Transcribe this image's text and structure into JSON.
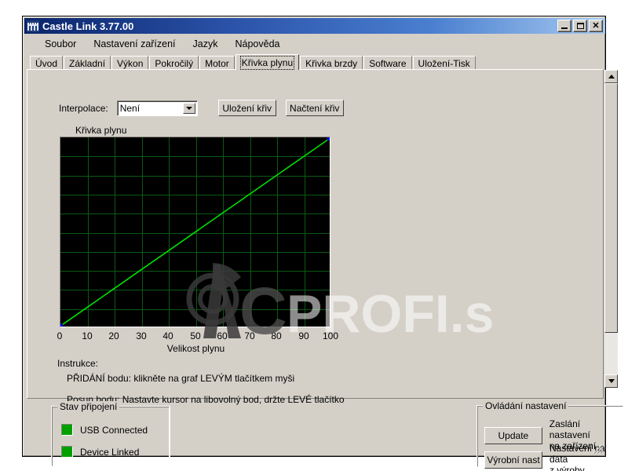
{
  "window": {
    "title": "Castle Link 3.77.00",
    "icon": "castle-icon",
    "buttons": {
      "minimize": "minimize-icon",
      "maximize": "maximize-icon",
      "close": "close-icon"
    }
  },
  "menubar": {
    "items": [
      {
        "label": "Soubor"
      },
      {
        "label": "Nastavení zařízení"
      },
      {
        "label": "Jazyk"
      },
      {
        "label": "Nápověda"
      }
    ]
  },
  "tabs": {
    "active_index": 5,
    "items": [
      {
        "label": "Úvod"
      },
      {
        "label": "Základní"
      },
      {
        "label": "Výkon"
      },
      {
        "label": "Pokročilý"
      },
      {
        "label": "Motor"
      },
      {
        "label": "Křivka plynu"
      },
      {
        "label": "Křivka brzdy"
      },
      {
        "label": "Software"
      },
      {
        "label": "Uložení-Tisk"
      }
    ]
  },
  "toolbar": {
    "interpolation_label": "Interpolace:",
    "interpolation_value": "Není",
    "interpolation_options": [
      "Není"
    ],
    "save_curve_label": "Uložení křiv",
    "load_curve_label": "Načtení křiv"
  },
  "chart_data": {
    "type": "line",
    "title": "Křivka plynu",
    "xlabel": "Velikost plynu",
    "ylabel": "",
    "xlim": [
      0,
      100
    ],
    "ylim": [
      0,
      100
    ],
    "xticks": [
      0,
      10,
      20,
      30,
      40,
      50,
      60,
      70,
      80,
      90,
      100
    ],
    "grid": true,
    "grid_color": "#0a5a14",
    "background": "#000000",
    "line_color": "#00e000",
    "point_color": "#0000ff",
    "legend": "none",
    "series": [
      {
        "name": "Křivka plynu",
        "x": [
          0,
          10,
          20,
          30,
          40,
          50,
          60,
          70,
          80,
          90,
          100
        ],
        "values": [
          0,
          10,
          20,
          30,
          40,
          50,
          60,
          70,
          80,
          90,
          100
        ]
      }
    ],
    "points": [
      {
        "x": 0,
        "y": 0
      },
      {
        "x": 100,
        "y": 100
      }
    ],
    "watermark": "RC PROFI.sk"
  },
  "instructions": {
    "heading": "Instrukce:",
    "lines": [
      "PŘIDÁNÍ bodu: klikněte na graf LEVÝM tlačítkem myši",
      "Posun bodu: Nastavte kursor na libovolný bod, držte LEVÉ tlačítko"
    ]
  },
  "scrollbar": {
    "up_icon": "triangle-up-icon",
    "down_icon": "triangle-down-icon"
  },
  "status_group": {
    "title": "Stav připojení",
    "items": [
      {
        "label": "USB Connected",
        "color": "#00a000"
      },
      {
        "label": "Device Linked",
        "color": "#00a000"
      }
    ]
  },
  "control_group": {
    "title": "Ovládání nastavení",
    "actions": [
      {
        "button": "Update",
        "description": "Zaslání nastavení\nna zařízení"
      },
      {
        "button": "Výrobní nast",
        "description": "Nastavení na data\nz výroby"
      }
    ]
  }
}
